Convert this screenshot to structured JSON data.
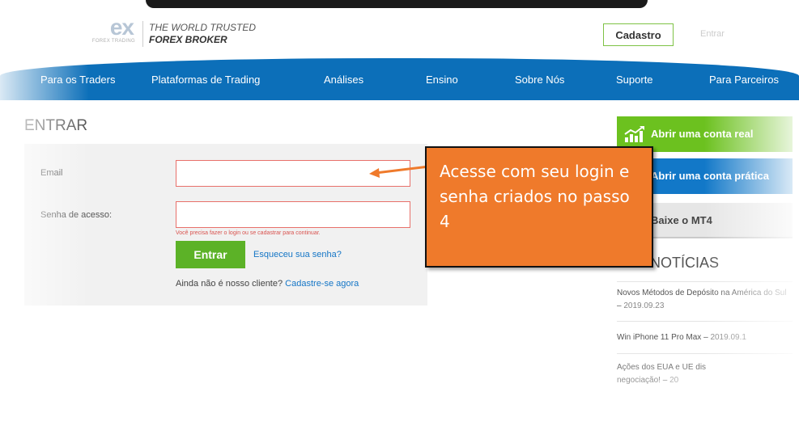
{
  "header": {
    "logo_text": "ex",
    "logo_subtext": "FOREX TRADING",
    "tagline_top": "THE WORLD TRUSTED",
    "tagline_bottom": "FOREX BROKER",
    "register_label": "Cadastro",
    "login_label": "Entrar"
  },
  "nav": {
    "items": [
      "Para os Traders",
      "Plataformas de Trading",
      "Análises",
      "Ensino",
      "Sobre Nós",
      "Suporte",
      "Para Parceiros"
    ]
  },
  "login": {
    "title": "ENTRAR",
    "email_label": "Email",
    "email_value": "",
    "password_label": "Senha de acesso:",
    "password_value": "",
    "error_text": "Você precisa fazer o login ou se cadastrar para continuar.",
    "submit_label": "Entrar",
    "forgot_label": "Esqueceu sua senha?",
    "not_client_text": "Ainda não é nosso cliente?",
    "register_link": "Cadastre-se agora"
  },
  "sidebar": {
    "real_account": "Abrir uma conta real",
    "demo_account": "Abrir uma conta prática",
    "download": "Baixe o MT4",
    "news_title": "SAS NOTÍCIAS",
    "news": [
      {
        "title": "Novos Métodos de Depósito na América do Sul",
        "date": "2019.09.23"
      },
      {
        "title": "Win iPhone 11 Pro Max",
        "date": "2019.09.1"
      },
      {
        "title": "Ações dos EUA e UE dis",
        "date": "20"
      }
    ],
    "news_item_3_line2": "negociação! –"
  },
  "callout": {
    "text": "Acesse com seu login e senha criados no passo 4"
  },
  "colors": {
    "nav_blue": "#0c6fb9",
    "green": "#5cb227",
    "callout_orange": "#ef7a2b",
    "error_red": "#e8706a"
  }
}
